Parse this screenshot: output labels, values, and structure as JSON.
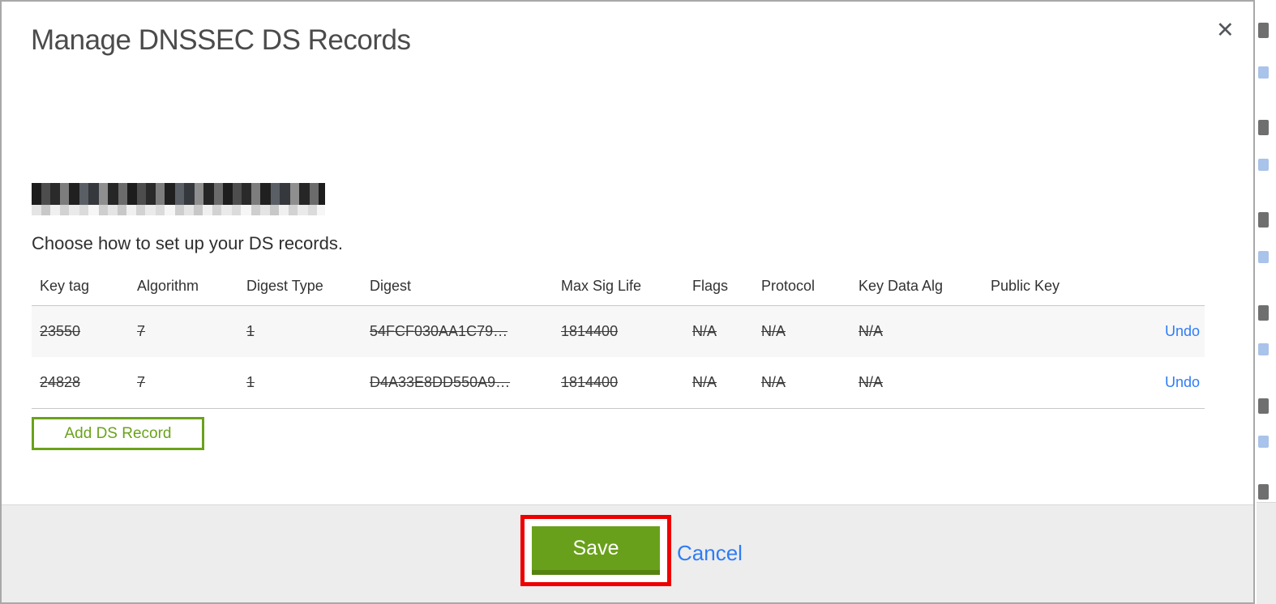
{
  "dialog": {
    "title": "Manage DNSSEC DS Records",
    "close_icon": "✕",
    "subtitle": "Choose how to set up your DS records."
  },
  "table": {
    "headers": [
      "Key tag",
      "Algorithm",
      "Digest Type",
      "Digest",
      "Max Sig Life",
      "Flags",
      "Protocol",
      "Key Data Alg",
      "Public Key"
    ],
    "rows": [
      {
        "cells": [
          "23550",
          "7",
          "1",
          "54FCF030AA1C79…",
          "1814400",
          "N/A",
          "N/A",
          "N/A",
          ""
        ],
        "action": "Undo",
        "struck": true
      },
      {
        "cells": [
          "24828",
          "7",
          "1",
          "D4A33E8DD550A9…",
          "1814400",
          "N/A",
          "N/A",
          "N/A",
          ""
        ],
        "action": "Undo",
        "struck": true
      }
    ]
  },
  "buttons": {
    "add_record": "Add DS Record",
    "save": "Save",
    "cancel": "Cancel"
  },
  "colors": {
    "save_green": "#69a01b",
    "save_green_dark": "#55830f",
    "outline_green": "#6aa21c",
    "link_blue": "#2e7cf6",
    "annotation_red": "#ee0000"
  }
}
